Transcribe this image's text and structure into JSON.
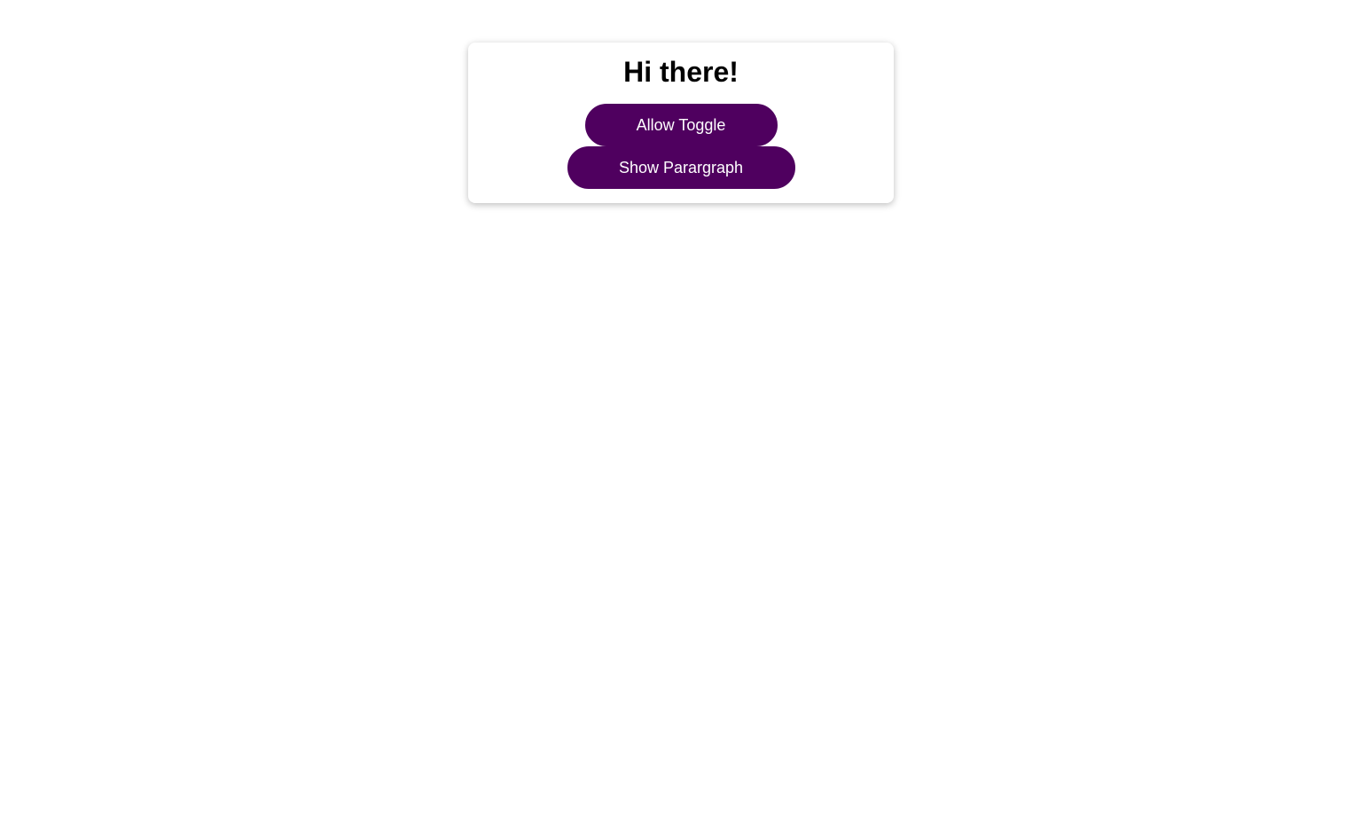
{
  "card": {
    "title": "Hi there!",
    "buttons": {
      "allow_toggle": "Allow Toggle",
      "show_paragraph": "Show Parargraph"
    }
  },
  "colors": {
    "button_background": "#4f005f",
    "button_text": "#ffffff",
    "card_background": "#ffffff",
    "page_background": "#ffffff"
  }
}
